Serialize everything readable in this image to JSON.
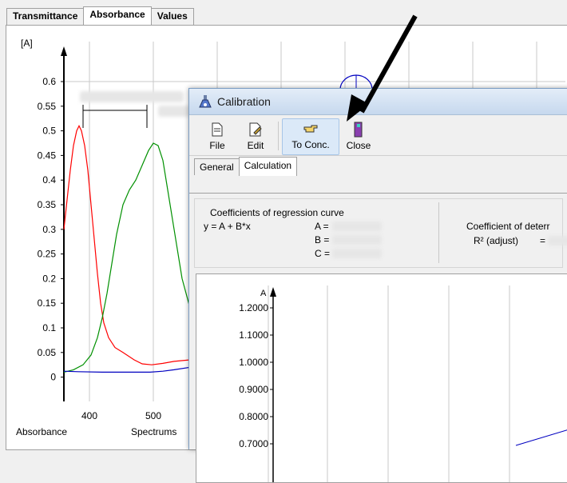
{
  "top_tabs": [
    {
      "label": "Transmittance",
      "active": false
    },
    {
      "label": "Absorbance",
      "active": true
    },
    {
      "label": "Values",
      "active": false
    }
  ],
  "main_chart": {
    "y_unit": "[A]",
    "x_label": "Absorbance",
    "x_label_right": "Spectrums",
    "y_ticks": [
      "0.6",
      "0.55",
      "0.5",
      "0.45",
      "0.4",
      "0.35",
      "0.3",
      "0.25",
      "0.2",
      "0.15",
      "0.1",
      "0.05",
      "0"
    ],
    "x_ticks": [
      "400",
      "500"
    ],
    "colors": {
      "red": "#ff0000",
      "green": "#009000",
      "blue": "#0000c0",
      "grid": "#c8c8c8"
    }
  },
  "dialog": {
    "title": "Calibration",
    "toolbar": [
      {
        "label": "File",
        "icon": "file-icon"
      },
      {
        "label": "Edit",
        "icon": "edit-icon"
      },
      {
        "label": "To Conc.",
        "icon": "pointing-hand-icon"
      },
      {
        "label": "Close",
        "icon": "door-close-icon"
      }
    ],
    "tabs": [
      {
        "label": "General",
        "active": false
      },
      {
        "label": "Calculation",
        "active": true
      }
    ],
    "coefficients": {
      "heading": "Coefficients of regression curve",
      "equation": "y = A + B*x",
      "a_label": "A =",
      "b_label": "B =",
      "c_label": "C ="
    },
    "determination": {
      "heading": "Coefficient of deterr",
      "r2_label": "R² (adjust)",
      "r2_eq": "="
    },
    "plot": {
      "y_unit": "A",
      "y_ticks": [
        "1.2000",
        "1.1000",
        "1.0000",
        "0.9000",
        "0.8000",
        "0.7000"
      ]
    }
  }
}
